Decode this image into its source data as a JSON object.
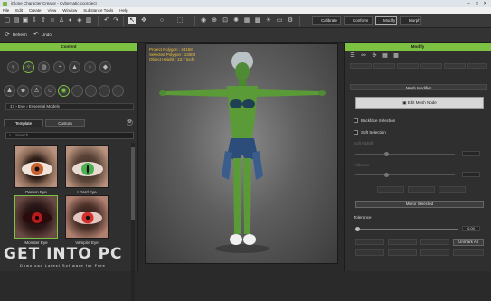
{
  "window": {
    "title": "iClone Character Creator - Cybernatic.ccproject"
  },
  "menu": [
    "File",
    "Edit",
    "Create",
    "View",
    "Window",
    "Substance Tools",
    "Help"
  ],
  "toolbar": {
    "calibrate": "Calibrate",
    "conform": "Conform",
    "modify": "Modify",
    "morph": "Morph",
    "refresh": "Refresh",
    "undo": "Undo"
  },
  "content_panel": {
    "header": "Content",
    "path": [
      "Eye",
      "Essential Models"
    ],
    "path_number": "17",
    "tabs": [
      "Template",
      "Custom"
    ],
    "search_placeholder": "Search",
    "items": [
      {
        "label": "Demon Eye",
        "iris": "#c9612e"
      },
      {
        "label": "Lizard Eye",
        "iris": "#4caf50"
      },
      {
        "label": "Monster Eye",
        "iris": "#b71c1c"
      },
      {
        "label": "Vampire Eye",
        "iris": "#d32f2f"
      }
    ]
  },
  "viewport": {
    "stats": [
      "Project Polygon : 43158",
      "Selected Polygon : 13308",
      "Object Height : 13.7 inch"
    ]
  },
  "modify_panel": {
    "header": "Modify",
    "section": "Mesh Modifier",
    "edit_mesh_button": "Edit Mesh Node",
    "backface_label": "Backface Selection",
    "soft_selection_label": "Soft Selection",
    "soft_falloff_label": "Soft Falloff",
    "fullness_label": "Fullness",
    "mirror_button": "Mirror Selected",
    "tolerance_label": "Tolerance",
    "tolerance_value": "0.00",
    "unmark_all": "Unmark All"
  },
  "watermark": {
    "line1": "GET INTO PC",
    "line2": "Download Latest Software for Free"
  },
  "colors": {
    "accent": "#7cc142",
    "stats": "#f0c040"
  }
}
